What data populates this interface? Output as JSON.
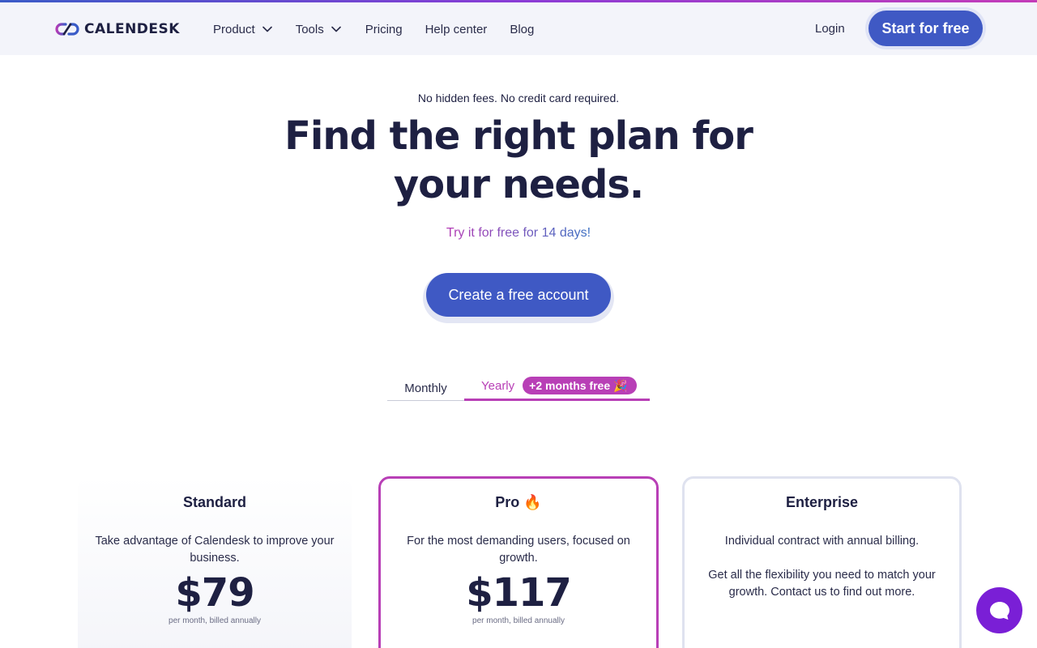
{
  "header": {
    "logo_text": "CALENDESK",
    "nav": [
      {
        "label": "Product",
        "dropdown": true
      },
      {
        "label": "Tools",
        "dropdown": true
      },
      {
        "label": "Pricing",
        "dropdown": false
      },
      {
        "label": "Help center",
        "dropdown": false
      },
      {
        "label": "Blog",
        "dropdown": false
      }
    ],
    "login_label": "Login",
    "start_label": "Start for free"
  },
  "hero": {
    "subhead": "No hidden fees. No credit card required.",
    "title": "Find the right plan for your needs.",
    "trial": "Try it for free for 14 days!",
    "cta_label": "Create a free account"
  },
  "billing_toggle": {
    "monthly_label": "Monthly",
    "yearly_label": "Yearly",
    "yearly_badge": "+2 months free 🎉",
    "selected": "Yearly"
  },
  "plans": [
    {
      "name": "Standard",
      "description": "Take advantage of Calendesk to improve your business.",
      "price": "$79",
      "price_note": "per month, billed annually"
    },
    {
      "name": "Pro 🔥",
      "description": "For the most demanding users, focused on growth.",
      "price": "$117",
      "price_note": "per month, billed annually"
    },
    {
      "name": "Enterprise",
      "description": "Individual contract with annual billing.",
      "description_2": "Get all the flexibility you need to match your growth. Contact us to find out more."
    }
  ],
  "colors": {
    "primary": "#3f59c4",
    "accent": "#b83fb6",
    "text": "#1e2042",
    "chat": "#7a1fd6"
  },
  "icons": {
    "chat": "chat-bubble-icon",
    "dropdown": "chevron-down-icon"
  }
}
